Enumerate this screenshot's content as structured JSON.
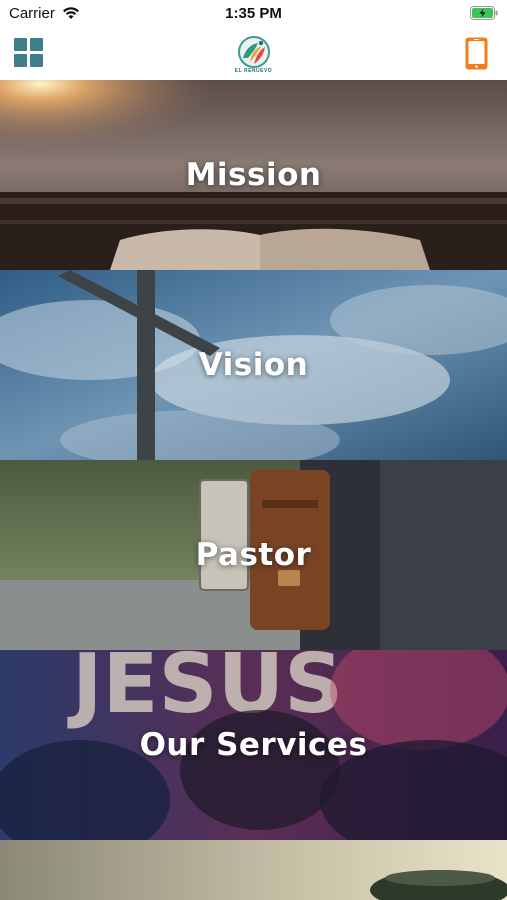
{
  "status_bar": {
    "carrier": "Carrier",
    "time": "1:35 PM"
  },
  "nav": {
    "logo_caption": "EL RENUEVO",
    "grid_icon": "grid-menu-icon",
    "phone_icon": "smartphone-icon",
    "accent_color": "#3f7f8b",
    "phone_color": "#f07c1c"
  },
  "tiles": [
    {
      "label": "Mission"
    },
    {
      "label": "Vision"
    },
    {
      "label": "Pastor"
    },
    {
      "label": "Our Services"
    },
    {
      "label": ""
    }
  ]
}
